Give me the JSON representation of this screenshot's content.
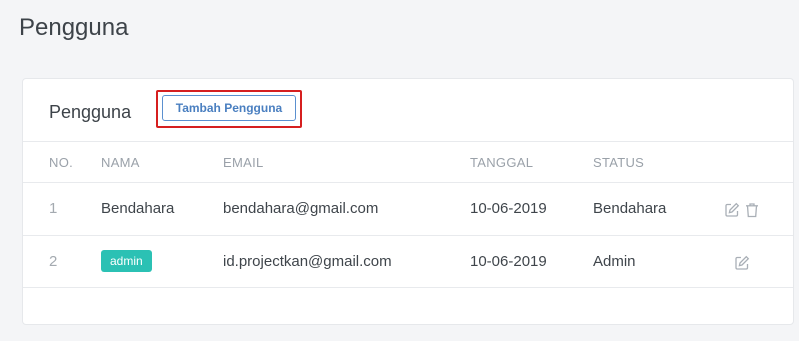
{
  "page": {
    "title": "Pengguna"
  },
  "card": {
    "title": "Pengguna",
    "add_button_label": "Tambah Pengguna"
  },
  "table": {
    "headers": {
      "no": "NO.",
      "nama": "NAMA",
      "email": "EMAIL",
      "tanggal": "TANGGAL",
      "status": "STATUS"
    },
    "rows": [
      {
        "no": "1",
        "nama": "Bendahara",
        "nama_is_badge": false,
        "email": "bendahara@gmail.com",
        "tanggal": "10-06-2019",
        "status": "Bendahara",
        "actions": [
          "edit-icon",
          "trash-icon"
        ]
      },
      {
        "no": "2",
        "nama": "admin",
        "nama_is_badge": true,
        "email": "id.projectkan@gmail.com",
        "tanggal": "10-06-2019",
        "status": "Admin",
        "actions": [
          "edit-icon"
        ]
      }
    ]
  },
  "colors": {
    "badge": "#2bc1b4",
    "button_border": "#5b90cf",
    "highlight": "#d61f1f"
  }
}
